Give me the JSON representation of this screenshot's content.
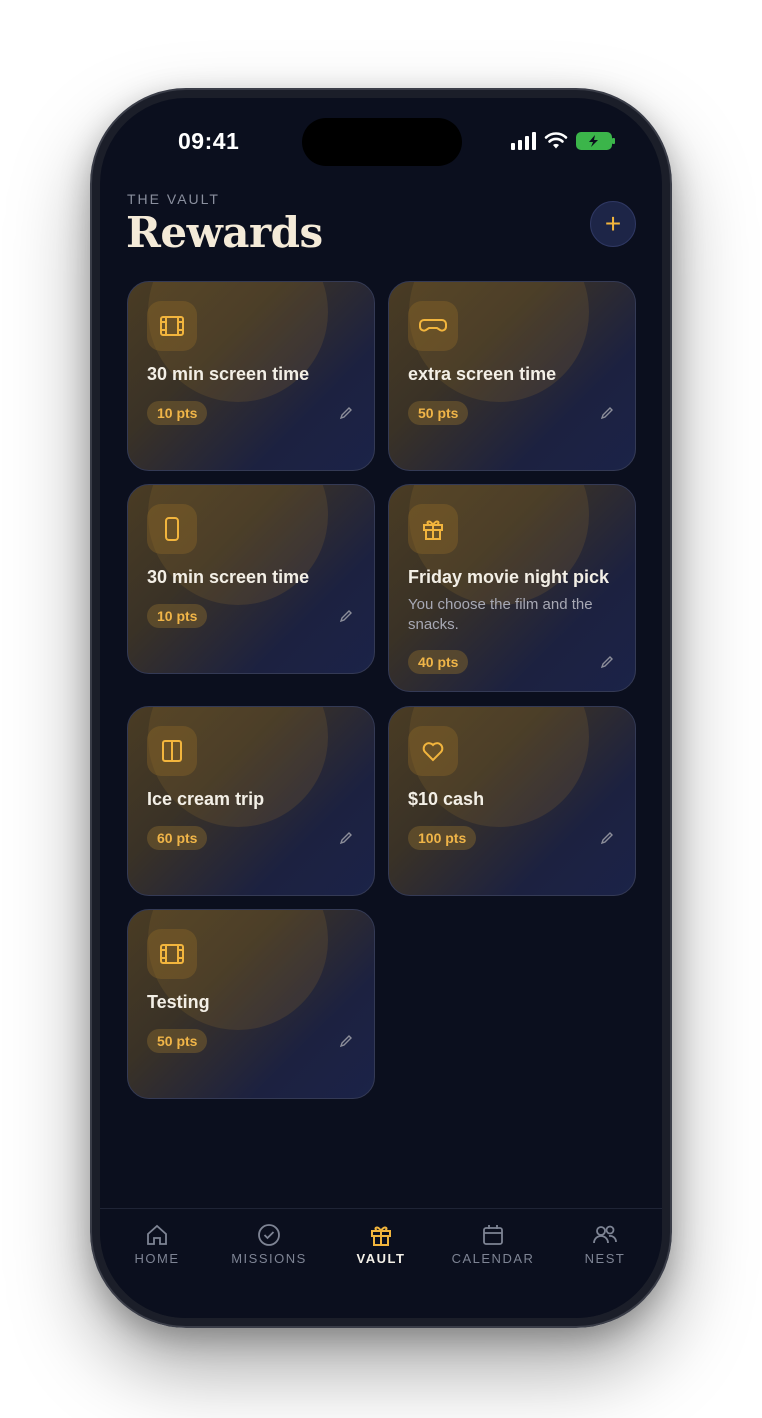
{
  "status": {
    "time": "09:41"
  },
  "header": {
    "eyebrow": "THE VAULT",
    "title": "Rewards"
  },
  "actions": {
    "add": "+"
  },
  "colors": {
    "accent": "#f2b53d",
    "background": "#0b0f1e"
  },
  "rewards": [
    {
      "title": "30 min screen time",
      "points": "10 pts",
      "icon": "film-icon"
    },
    {
      "title": "extra screen time",
      "points": "50 pts",
      "icon": "gamepad-icon"
    },
    {
      "title": "30 min screen time",
      "points": "10 pts",
      "icon": "phone-icon"
    },
    {
      "title": "Friday movie night pick",
      "description": "You choose the film and the snacks.",
      "points": "40 pts",
      "icon": "gift-icon"
    },
    {
      "title": "Ice cream trip",
      "points": "60 pts",
      "icon": "columns-icon"
    },
    {
      "title": "$10 cash",
      "points": "100 pts",
      "icon": "heart-icon"
    },
    {
      "title": "Testing",
      "points": "50 pts",
      "icon": "film-icon"
    }
  ],
  "tabs": [
    {
      "label": "HOME",
      "icon": "home-icon"
    },
    {
      "label": "MISSIONS",
      "icon": "check-circle-icon"
    },
    {
      "label": "VAULT",
      "icon": "gift-icon",
      "active": true
    },
    {
      "label": "CALENDAR",
      "icon": "calendar-icon"
    },
    {
      "label": "NEST",
      "icon": "users-icon"
    }
  ]
}
